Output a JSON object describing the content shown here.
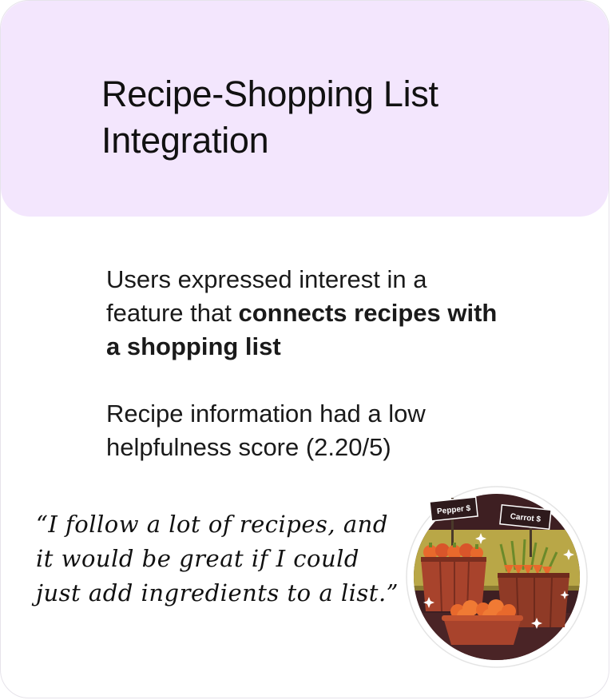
{
  "header": {
    "title": "Recipe-Shopping List Integration"
  },
  "findings": {
    "first_lead": "Users expressed interest in a feature that ",
    "first_emphasis": "connects recipes with a shopping list",
    "second": "Recipe information had a low helpfulness score (2.20/5)"
  },
  "quote": {
    "text": "“I follow a lot of recipes, and it would be great if I could just add ingredients to a list.”"
  },
  "illustration": {
    "icon": "market-stall-icon",
    "sign_left": "Pepper $",
    "sign_right": "Carrot $",
    "colors": {
      "header_bg": "#f3e6fd",
      "circle_bg": "#3e1f22",
      "crate": "#a8432c",
      "produce": "#e8692c",
      "greens": "#6b8a2a"
    }
  }
}
